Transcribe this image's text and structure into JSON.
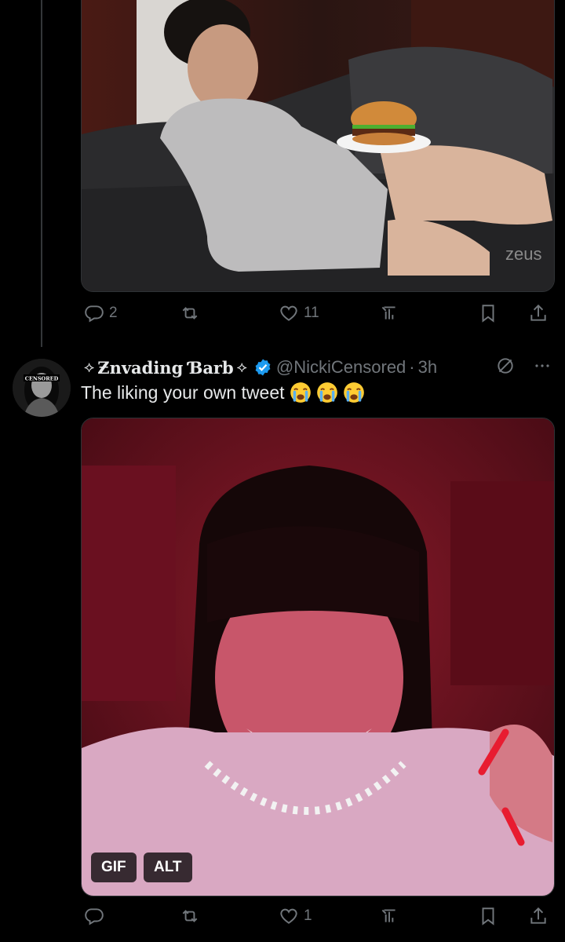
{
  "tweet1": {
    "media": {
      "watermark": "zeus"
    },
    "actions": {
      "reply_count": "2",
      "retweet_count": "",
      "like_count": "11",
      "view_count": ""
    }
  },
  "tweet2": {
    "display_name": "Ƶnvading Ɓarb",
    "name_decoration": "⟡",
    "handle": "@NickiCensored",
    "separator": "·",
    "time": "3h",
    "text": "The liking your own tweet",
    "avatar_label": "CENSORED",
    "media": {
      "gif_badge": "GIF",
      "alt_badge": "ALT"
    },
    "actions": {
      "reply_count": "",
      "retweet_count": "",
      "like_count": "1",
      "view_count": ""
    }
  },
  "colors": {
    "background": "#000000",
    "muted": "#71767b",
    "verified": "#1d9bf0",
    "text": "#e7e9ea"
  },
  "icons": [
    "reply-icon",
    "retweet-icon",
    "like-icon",
    "views-icon",
    "bookmark-icon",
    "share-icon",
    "verified-icon",
    "grok-icon",
    "more-icon",
    "loudly-crying-emoji"
  ]
}
